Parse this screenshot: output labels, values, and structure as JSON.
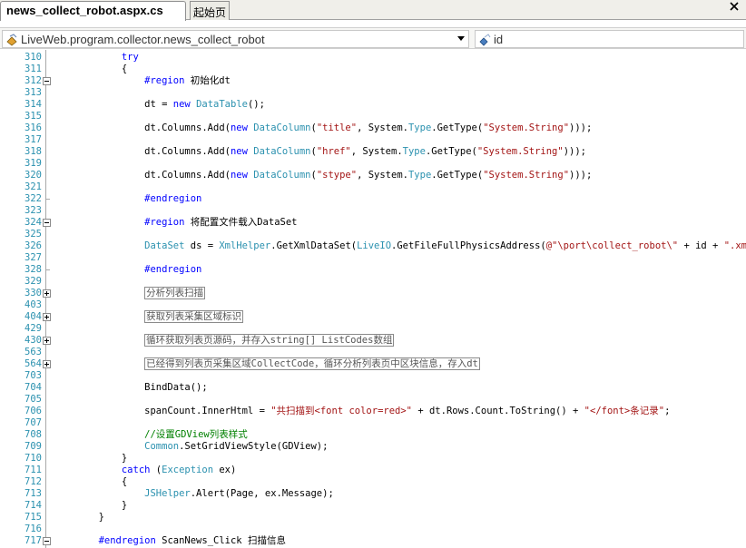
{
  "tabs": [
    {
      "label": "news_collect_robot.aspx.cs"
    },
    {
      "label": "起始页"
    }
  ],
  "nav": {
    "class_combo": "LiveWeb.program.collector.news_collect_robot",
    "member_combo": "id"
  },
  "lines": [
    {
      "n": "310",
      "fold": "",
      "segs": [
        [
          "kw",
          "            try"
        ]
      ]
    },
    {
      "n": "311",
      "fold": "",
      "segs": [
        [
          "",
          "            {"
        ]
      ]
    },
    {
      "n": "312",
      "fold": "minus",
      "segs": [
        [
          "kw",
          "                #region"
        ],
        [
          "",
          " 初始化dt"
        ]
      ]
    },
    {
      "n": "313",
      "fold": "",
      "segs": []
    },
    {
      "n": "314",
      "fold": "",
      "segs": [
        [
          "",
          "                dt = "
        ],
        [
          "kw",
          "new"
        ],
        [
          "",
          " "
        ],
        [
          "ty",
          "DataTable"
        ],
        [
          "",
          "();"
        ]
      ]
    },
    {
      "n": "315",
      "fold": "",
      "segs": []
    },
    {
      "n": "316",
      "fold": "",
      "segs": [
        [
          "",
          "                dt.Columns.Add("
        ],
        [
          "kw",
          "new"
        ],
        [
          "",
          " "
        ],
        [
          "ty",
          "DataColumn"
        ],
        [
          "",
          "("
        ],
        [
          "st",
          "\"title\""
        ],
        [
          "",
          ", System."
        ],
        [
          "ty",
          "Type"
        ],
        [
          "",
          ".GetType("
        ],
        [
          "st",
          "\"System.String\""
        ],
        [
          "",
          ")));"
        ]
      ]
    },
    {
      "n": "317",
      "fold": "",
      "segs": []
    },
    {
      "n": "318",
      "fold": "",
      "segs": [
        [
          "",
          "                dt.Columns.Add("
        ],
        [
          "kw",
          "new"
        ],
        [
          "",
          " "
        ],
        [
          "ty",
          "DataColumn"
        ],
        [
          "",
          "("
        ],
        [
          "st",
          "\"href\""
        ],
        [
          "",
          ", System."
        ],
        [
          "ty",
          "Type"
        ],
        [
          "",
          ".GetType("
        ],
        [
          "st",
          "\"System.String\""
        ],
        [
          "",
          ")));"
        ]
      ]
    },
    {
      "n": "319",
      "fold": "",
      "segs": []
    },
    {
      "n": "320",
      "fold": "",
      "segs": [
        [
          "",
          "                dt.Columns.Add("
        ],
        [
          "kw",
          "new"
        ],
        [
          "",
          " "
        ],
        [
          "ty",
          "DataColumn"
        ],
        [
          "",
          "("
        ],
        [
          "st",
          "\"stype\""
        ],
        [
          "",
          ", System."
        ],
        [
          "ty",
          "Type"
        ],
        [
          "",
          ".GetType("
        ],
        [
          "st",
          "\"System.String\""
        ],
        [
          "",
          ")));"
        ]
      ]
    },
    {
      "n": "321",
      "fold": "",
      "segs": []
    },
    {
      "n": "322",
      "fold": "end",
      "segs": [
        [
          "kw",
          "                #endregion"
        ]
      ]
    },
    {
      "n": "323",
      "fold": "",
      "segs": []
    },
    {
      "n": "324",
      "fold": "minus",
      "segs": [
        [
          "kw",
          "                #region"
        ],
        [
          "",
          " 将配置文件载入DataSet"
        ]
      ]
    },
    {
      "n": "325",
      "fold": "",
      "segs": []
    },
    {
      "n": "326",
      "fold": "",
      "segs": [
        [
          "",
          "                "
        ],
        [
          "ty",
          "DataSet"
        ],
        [
          "",
          " ds = "
        ],
        [
          "ty",
          "XmlHelper"
        ],
        [
          "",
          ".GetXmlDataSet("
        ],
        [
          "ty",
          "LiveIO"
        ],
        [
          "",
          ".GetFileFullPhysicsAddress("
        ],
        [
          "st",
          "@\"\\port\\collect_robot\\\""
        ],
        [
          "",
          " + id + "
        ],
        [
          "st",
          "\".xml\""
        ],
        [
          "",
          "));"
        ]
      ]
    },
    {
      "n": "327",
      "fold": "",
      "segs": []
    },
    {
      "n": "328",
      "fold": "end",
      "segs": [
        [
          "kw",
          "                #endregion"
        ]
      ]
    },
    {
      "n": "329",
      "fold": "",
      "segs": []
    },
    {
      "n": "330",
      "fold": "plus",
      "segs": [
        [
          "",
          "                "
        ],
        [
          "col",
          "分析列表扫描"
        ]
      ]
    },
    {
      "n": "403",
      "fold": "",
      "segs": []
    },
    {
      "n": "404",
      "fold": "plus",
      "segs": [
        [
          "",
          "                "
        ],
        [
          "col",
          "获取列表采集区域标识"
        ]
      ]
    },
    {
      "n": "429",
      "fold": "",
      "segs": []
    },
    {
      "n": "430",
      "fold": "plus",
      "segs": [
        [
          "",
          "                "
        ],
        [
          "col",
          "循环获取列表页源码，并存入string[] ListCodes数组"
        ]
      ]
    },
    {
      "n": "563",
      "fold": "",
      "segs": []
    },
    {
      "n": "564",
      "fold": "plus",
      "segs": [
        [
          "",
          "                "
        ],
        [
          "col",
          "已经得到列表页采集区域CollectCode，循环分析列表页中区块信息，存入dt"
        ]
      ]
    },
    {
      "n": "703",
      "fold": "",
      "segs": []
    },
    {
      "n": "704",
      "fold": "",
      "segs": [
        [
          "",
          "                BindData();"
        ]
      ]
    },
    {
      "n": "705",
      "fold": "",
      "segs": []
    },
    {
      "n": "706",
      "fold": "",
      "segs": [
        [
          "",
          "                spanCount.InnerHtml = "
        ],
        [
          "st",
          "\"共扫描到<font color=red>\""
        ],
        [
          "",
          " + dt.Rows.Count.ToString() + "
        ],
        [
          "st",
          "\"</font>条记录\""
        ],
        [
          "",
          ";"
        ]
      ]
    },
    {
      "n": "707",
      "fold": "",
      "segs": []
    },
    {
      "n": "708",
      "fold": "",
      "segs": [
        [
          "cm",
          "                //设置GDView列表样式"
        ]
      ]
    },
    {
      "n": "709",
      "fold": "",
      "segs": [
        [
          "",
          "                "
        ],
        [
          "ty",
          "Common"
        ],
        [
          "",
          ".SetGridViewStyle(GDView);"
        ]
      ]
    },
    {
      "n": "710",
      "fold": "",
      "segs": [
        [
          "",
          "            }"
        ]
      ]
    },
    {
      "n": "711",
      "fold": "",
      "segs": [
        [
          "kw",
          "            catch"
        ],
        [
          "",
          " ("
        ],
        [
          "ty",
          "Exception"
        ],
        [
          "",
          " ex)"
        ]
      ]
    },
    {
      "n": "712",
      "fold": "",
      "segs": [
        [
          "",
          "            {"
        ]
      ]
    },
    {
      "n": "713",
      "fold": "",
      "segs": [
        [
          "",
          "                "
        ],
        [
          "ty",
          "JSHelper"
        ],
        [
          "",
          ".Alert(Page, ex.Message);"
        ]
      ]
    },
    {
      "n": "714",
      "fold": "",
      "segs": [
        [
          "",
          "            }"
        ]
      ]
    },
    {
      "n": "715",
      "fold": "",
      "segs": [
        [
          "",
          "        }"
        ]
      ]
    },
    {
      "n": "716",
      "fold": "",
      "segs": []
    },
    {
      "n": "717",
      "fold": "minus",
      "segs": [
        [
          "kw",
          "        #endregion"
        ],
        [
          "",
          " ScanNews_Click 扫描信息"
        ]
      ]
    }
  ]
}
